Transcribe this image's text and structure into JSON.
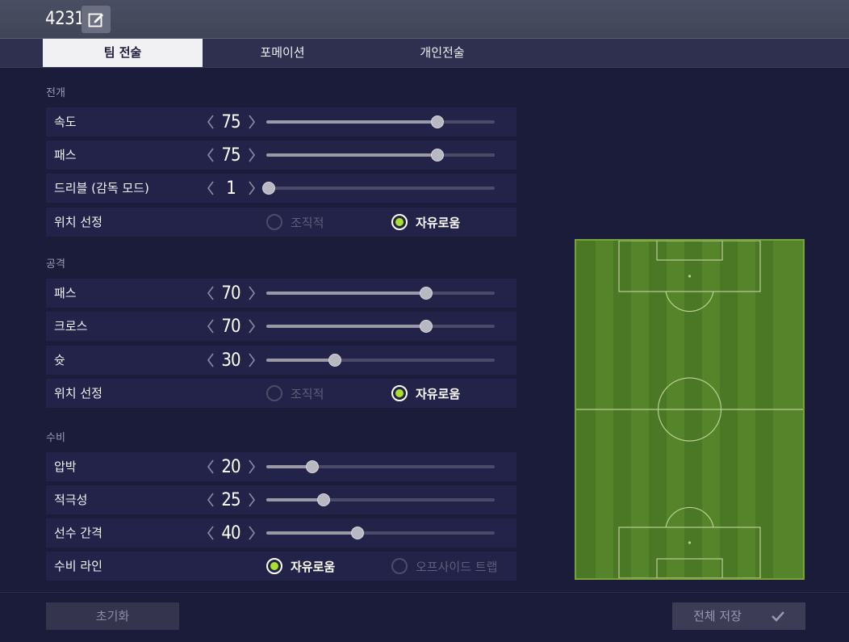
{
  "header": {
    "formation_name": "4231"
  },
  "tabs": [
    {
      "label": "팀 전술",
      "active": true
    },
    {
      "label": "포메이션",
      "active": false
    },
    {
      "label": "개인전술",
      "active": false
    }
  ],
  "sections": {
    "buildup": {
      "title": "전개",
      "speed": {
        "label": "속도",
        "value": "75",
        "level": 75
      },
      "passing": {
        "label": "패스",
        "value": "75",
        "level": 75
      },
      "dribbling": {
        "label": "드리블 (감독 모드)",
        "value": "1",
        "level": 1
      },
      "positioning": {
        "label": "위치 선정",
        "option_a": "조직적",
        "option_b": "자유로움",
        "selected": "자유로움"
      }
    },
    "attack": {
      "title": "공격",
      "passing": {
        "label": "패스",
        "value": "70",
        "level": 70
      },
      "crossing": {
        "label": "크로스",
        "value": "70",
        "level": 70
      },
      "shooting": {
        "label": "슛",
        "value": "30",
        "level": 30
      },
      "positioning": {
        "label": "위치 선정",
        "option_a": "조직적",
        "option_b": "자유로움",
        "selected": "자유로움"
      }
    },
    "defence": {
      "title": "수비",
      "pressure": {
        "label": "압박",
        "value": "20",
        "level": 20
      },
      "aggression": {
        "label": "적극성",
        "value": "25",
        "level": 25
      },
      "width": {
        "label": "선수 간격",
        "value": "40",
        "level": 40
      },
      "line": {
        "label": "수비 라인",
        "option_a": "자유로움",
        "option_b": "오프사이드 트랩",
        "selected": "자유로움"
      }
    }
  },
  "footer": {
    "reset_label": "초기화",
    "save_label": "전체 저장"
  },
  "colors": {
    "background": "#1b1b3a",
    "row_background": "#23234a",
    "radio_selected": "#a6e22e",
    "pitch_green": "#4d7a25"
  },
  "icons": {
    "edit": "edit-icon",
    "arrow_left": "chevron-left-icon",
    "arrow_right": "chevron-right-icon",
    "save": "check-icon"
  }
}
